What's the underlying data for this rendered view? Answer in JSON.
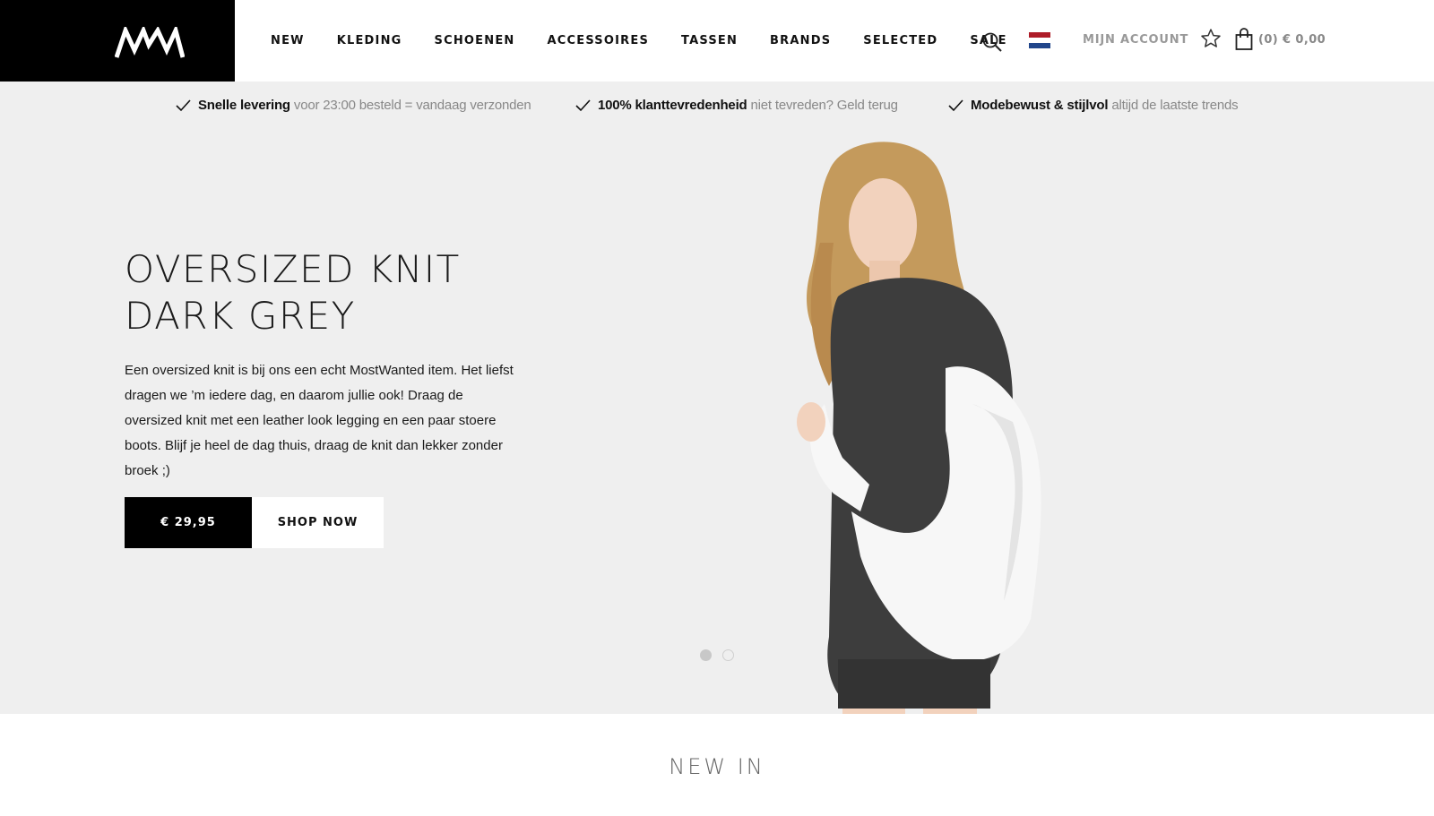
{
  "brand": {
    "logo_text": "MW"
  },
  "nav": {
    "items": [
      "NEW",
      "KLEDING",
      "SCHOENEN",
      "ACCESSOIRES",
      "TASSEN",
      "BRANDS",
      "SELECTED",
      "SALE"
    ]
  },
  "header": {
    "search_icon": "search-icon",
    "flag_icon": "netherlands-flag-icon",
    "flag_colors": [
      "#ae1c28",
      "#ffffff",
      "#21468b"
    ],
    "account_label": "MIJN ACCOUNT",
    "wishlist_icon": "star-icon",
    "cart_icon": "shopping-bag-icon",
    "cart_text": "(0) € 0,00"
  },
  "usps": [
    {
      "strong": "Snelle levering",
      "text": "voor 23:00 besteld = vandaag verzonden"
    },
    {
      "strong": "100% klanttevredenheid",
      "text": "niet tevreden? Geld terug"
    },
    {
      "strong": "Modebewust & stijlvol",
      "text": "altijd de laatste trends"
    }
  ],
  "hero": {
    "title_line1": "OVERSIZED KNIT",
    "title_line2": "DARK GREY",
    "description": "Een oversized knit is bij ons een echt MostWanted item. Het liefst dragen we ’m iedere dag, en daarom jullie ook! Draag de oversized knit met een leather look legging en een paar stoere boots. Blijf je heel de dag thuis, draag de knit dan lekker zonder broek ;)",
    "price_label": "€ 29,95",
    "cta_label": "SHOP NOW",
    "slides_total": 2,
    "active_slide": 1
  },
  "sections": {
    "new_in_title": "NEW IN"
  },
  "colors": {
    "header_logo_bg": "#000000",
    "hero_bg": "#efefef",
    "muted_text": "#888888"
  }
}
